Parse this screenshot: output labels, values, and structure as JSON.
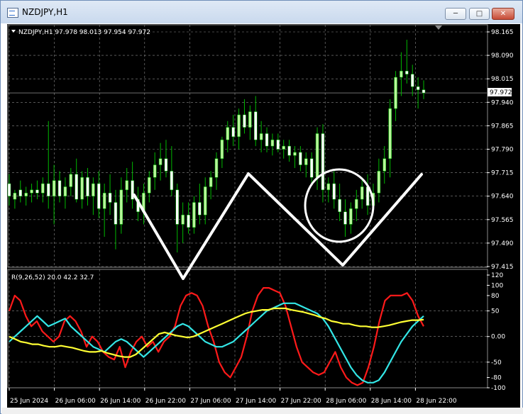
{
  "window": {
    "title": "NZDJPY,H1",
    "minimize_glyph": "─",
    "maximize_glyph": "□",
    "close_glyph": "✕"
  },
  "chart": {
    "header": "NZDJPY,H1  97.978 98.013 97.954 97.972",
    "current_price_label": "97.972",
    "indicator_label": "R(9,26,52) 20.0 42.2 32.7"
  },
  "colors": {
    "background": "#000000",
    "grid": "#8a8a8a",
    "candle_up": "#b7f59a",
    "candle_down": "#ffffff",
    "wick": "#00b800",
    "annotation": "#ffffff",
    "series_red": "#ff1a1a",
    "series_cyan": "#33e6e6",
    "series_yellow": "#ffff33"
  },
  "chart_data": [
    {
      "type": "candlestick",
      "symbol": "NZDJPY",
      "timeframe": "H1",
      "ylim": [
        97.415,
        98.165
      ],
      "y_ticks": [
        "98.165",
        "98.090",
        "98.015",
        "97.940",
        "97.865",
        "97.790",
        "97.715",
        "97.640",
        "97.565",
        "97.490",
        "97.415"
      ],
      "x_ticks": [
        "25 Jun 2024",
        "26 Jun 06:00",
        "26 Jun 14:00",
        "26 Jun 22:00",
        "27 Jun 06:00",
        "27 Jun 14:00",
        "27 Jun 22:00",
        "28 Jun 06:00",
        "28 Jun 14:00",
        "28 Jun 22:00"
      ],
      "ohlc": [
        [
          97.68,
          97.71,
          97.61,
          97.64
        ],
        [
          97.63,
          97.66,
          97.6,
          97.65
        ],
        [
          97.66,
          97.69,
          97.62,
          97.64
        ],
        [
          97.64,
          97.67,
          97.61,
          97.65
        ],
        [
          97.65,
          97.68,
          97.62,
          97.66
        ],
        [
          97.66,
          97.69,
          97.63,
          97.65
        ],
        [
          97.65,
          97.7,
          97.62,
          97.68
        ],
        [
          97.68,
          97.88,
          97.6,
          97.64
        ],
        [
          97.64,
          97.74,
          97.55,
          97.69
        ],
        [
          97.69,
          97.72,
          97.62,
          97.64
        ],
        [
          97.64,
          97.7,
          97.6,
          97.67
        ],
        [
          97.67,
          97.73,
          97.64,
          97.71
        ],
        [
          97.71,
          97.76,
          97.62,
          97.63
        ],
        [
          97.63,
          97.72,
          97.6,
          97.7
        ],
        [
          97.7,
          97.73,
          97.61,
          97.64
        ],
        [
          97.64,
          97.7,
          97.58,
          97.68
        ],
        [
          97.68,
          97.72,
          97.57,
          97.6
        ],
        [
          97.6,
          97.68,
          97.51,
          97.65
        ],
        [
          97.65,
          97.71,
          97.58,
          97.62
        ],
        [
          97.62,
          97.66,
          97.47,
          97.55
        ],
        [
          97.55,
          97.7,
          97.52,
          97.66
        ],
        [
          97.66,
          97.73,
          97.62,
          97.69
        ],
        [
          97.69,
          97.75,
          97.6,
          97.63
        ],
        [
          97.63,
          97.67,
          97.56,
          97.59
        ],
        [
          97.59,
          97.68,
          97.55,
          97.65
        ],
        [
          97.65,
          97.72,
          97.62,
          97.7
        ],
        [
          97.7,
          97.78,
          97.66,
          97.74
        ],
        [
          97.74,
          97.81,
          97.69,
          97.76
        ],
        [
          97.76,
          97.82,
          97.7,
          97.72
        ],
        [
          97.72,
          97.8,
          97.64,
          97.66
        ],
        [
          97.66,
          97.68,
          97.46,
          97.55
        ],
        [
          97.55,
          97.62,
          97.49,
          97.58
        ],
        [
          97.58,
          97.62,
          97.52,
          97.54
        ],
        [
          97.54,
          97.64,
          97.52,
          97.62
        ],
        [
          97.62,
          97.68,
          97.55,
          97.58
        ],
        [
          97.58,
          97.7,
          97.55,
          97.67
        ],
        [
          97.67,
          97.72,
          97.63,
          97.7
        ],
        [
          97.7,
          97.78,
          97.66,
          97.76
        ],
        [
          97.76,
          97.83,
          97.73,
          97.82
        ],
        [
          97.82,
          97.88,
          97.78,
          97.86
        ],
        [
          97.86,
          97.9,
          97.8,
          97.83
        ],
        [
          97.83,
          97.92,
          97.79,
          97.9
        ],
        [
          97.9,
          97.95,
          97.84,
          97.86
        ],
        [
          97.86,
          97.93,
          97.82,
          97.91
        ],
        [
          97.91,
          97.96,
          97.8,
          97.82
        ],
        [
          97.82,
          97.88,
          97.78,
          97.84
        ],
        [
          97.84,
          97.86,
          97.78,
          97.8
        ],
        [
          97.8,
          97.84,
          97.77,
          97.82
        ],
        [
          97.82,
          97.84,
          97.78,
          97.79
        ],
        [
          97.79,
          97.82,
          97.76,
          97.8
        ],
        [
          97.8,
          97.82,
          97.75,
          97.77
        ],
        [
          97.77,
          97.8,
          97.73,
          97.78
        ],
        [
          97.78,
          97.8,
          97.72,
          97.74
        ],
        [
          97.74,
          97.78,
          97.7,
          97.76
        ],
        [
          97.76,
          97.78,
          97.68,
          97.7
        ],
        [
          97.7,
          97.86,
          97.66,
          97.84
        ],
        [
          97.84,
          97.87,
          97.62,
          97.66
        ],
        [
          97.66,
          97.7,
          97.62,
          97.68
        ],
        [
          97.68,
          97.72,
          97.6,
          97.63
        ],
        [
          97.63,
          97.68,
          97.56,
          97.59
        ],
        [
          97.59,
          97.63,
          97.51,
          97.55
        ],
        [
          97.55,
          97.62,
          97.52,
          97.6
        ],
        [
          97.6,
          97.66,
          97.56,
          97.63
        ],
        [
          97.63,
          97.7,
          97.6,
          97.67
        ],
        [
          97.67,
          97.71,
          97.58,
          97.61
        ],
        [
          97.61,
          97.68,
          97.59,
          97.65
        ],
        [
          97.65,
          97.76,
          97.62,
          97.72
        ],
        [
          97.72,
          97.8,
          97.68,
          97.76
        ],
        [
          97.76,
          97.95,
          97.7,
          97.92
        ],
        [
          97.92,
          98.04,
          97.88,
          98.02
        ],
        [
          98.02,
          98.1,
          97.96,
          98.04
        ],
        [
          98.04,
          98.14,
          98.0,
          98.03
        ],
        [
          98.03,
          98.06,
          97.96,
          97.99
        ],
        [
          97.99,
          98.02,
          97.92,
          97.98
        ],
        [
          97.98,
          98.01,
          97.95,
          97.97
        ]
      ]
    },
    {
      "type": "line",
      "name": "R(9,26,52)",
      "ylim": [
        -100,
        120
      ],
      "y_ticks": [
        "120",
        "100",
        "80",
        "50",
        "0.00",
        "-50",
        "-80",
        "-100"
      ],
      "last_values": [
        20.0,
        42.2,
        32.7
      ],
      "series": [
        {
          "color": "#ff1a1a",
          "values": [
            50,
            80,
            70,
            40,
            20,
            30,
            10,
            0,
            -10,
            0,
            30,
            40,
            30,
            10,
            -20,
            0,
            -10,
            -30,
            -40,
            -45,
            -20,
            -60,
            -30,
            -10,
            0,
            -20,
            -10,
            -30,
            -10,
            0,
            20,
            60,
            80,
            85,
            80,
            60,
            20,
            -10,
            -50,
            -70,
            -80,
            -60,
            -40,
            0,
            50,
            80,
            95,
            95,
            90,
            85,
            60,
            20,
            -20,
            -50,
            -60,
            -70,
            -75,
            -70,
            -50,
            -30,
            -60,
            -80,
            -90,
            -95,
            -90,
            -60,
            -20,
            30,
            70,
            80,
            80,
            80,
            85,
            70,
            40,
            20
          ]
        },
        {
          "color": "#33e6e6",
          "values": [
            -10,
            0,
            10,
            20,
            30,
            40,
            30,
            20,
            25,
            30,
            35,
            20,
            10,
            0,
            -10,
            -20,
            -25,
            -30,
            -20,
            -10,
            -5,
            -10,
            -20,
            -30,
            -40,
            -30,
            -20,
            -10,
            0,
            10,
            20,
            25,
            20,
            10,
            0,
            -10,
            -15,
            -20,
            -20,
            -15,
            -10,
            0,
            10,
            20,
            30,
            40,
            50,
            55,
            60,
            65,
            65,
            65,
            60,
            55,
            50,
            45,
            35,
            20,
            0,
            -20,
            -40,
            -60,
            -75,
            -85,
            -90,
            -90,
            -85,
            -70,
            -50,
            -30,
            -10,
            5,
            20,
            30,
            40
          ]
        },
        {
          "color": "#ffff33",
          "values": [
            0,
            -5,
            -10,
            -12,
            -15,
            -15,
            -18,
            -20,
            -20,
            -18,
            -20,
            -22,
            -25,
            -28,
            -30,
            -30,
            -28,
            -32,
            -35,
            -38,
            -40,
            -40,
            -35,
            -25,
            -15,
            -5,
            5,
            8,
            5,
            2,
            0,
            -2,
            0,
            5,
            10,
            15,
            20,
            25,
            30,
            35,
            40,
            45,
            48,
            50,
            52,
            52,
            55,
            55,
            55,
            52,
            50,
            48,
            45,
            42,
            38,
            35,
            30,
            28,
            25,
            25,
            22,
            20,
            20,
            18,
            18,
            20,
            22,
            25,
            28,
            30,
            32,
            32,
            33
          ]
        }
      ]
    }
  ]
}
